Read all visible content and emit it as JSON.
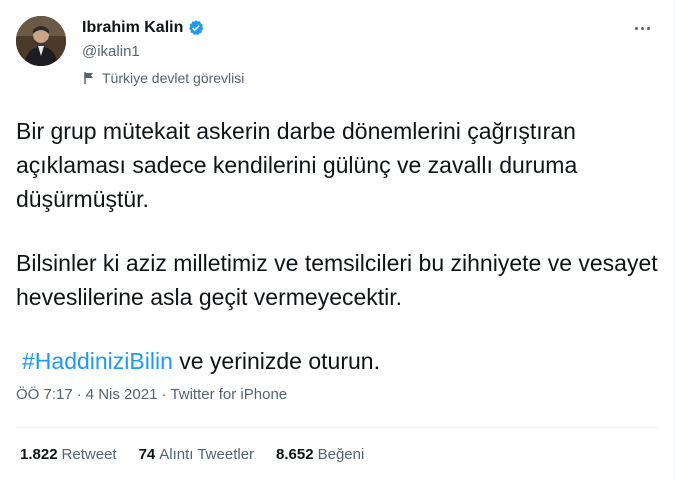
{
  "author": {
    "display_name": "Ibrahim Kalin",
    "handle": "@ikalin1",
    "label": "Türkiye devlet görevlisi",
    "verified_icon": "verified-badge-icon",
    "avatar_icon": "profile-photo"
  },
  "tweet": {
    "paragraph_1": "Bir grup mütekait askerin darbe dönemlerini çağrıştıran açıklaması sadece kendilerini gülünç ve zavallı duruma düşürmüştür.",
    "paragraph_2": "Bilsinler ki aziz milletimiz ve temsilcileri bu zihniyete ve vesayet heveslilerine asla geçit vermeyecektir.",
    "hashtag": "#HaddiniziBilin",
    "paragraph_3_rest": "ve yerinizde oturun."
  },
  "meta": {
    "time": "ÖÖ 7:17",
    "separator": "·",
    "date": "4 Nis 2021",
    "source": "Twitter for iPhone"
  },
  "stats": {
    "retweets_count": "1.822",
    "retweets_label": "Retweet",
    "quotes_count": "74",
    "quotes_label": "Alıntı Tweetler",
    "likes_count": "8.652",
    "likes_label": "Beğeni"
  },
  "colors": {
    "accent": "#1d9bf0",
    "secondary_text": "#536471",
    "primary_text": "#0f1419"
  }
}
